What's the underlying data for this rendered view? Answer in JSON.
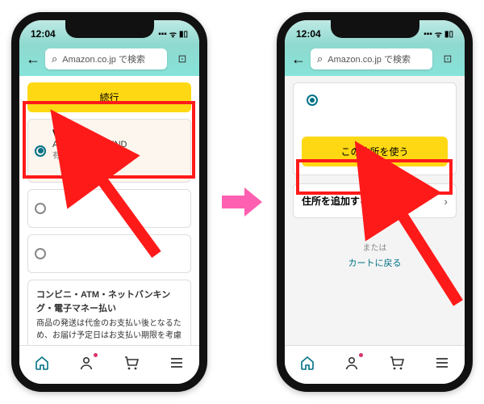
{
  "status": {
    "time": "12:04",
    "signal": "▪▪▪",
    "wifi": "ᯤ",
    "battery": "▮▯"
  },
  "header": {
    "search_placeholder": "Amazon.co.jp で検索"
  },
  "left": {
    "continue_label": "続行",
    "payment": {
      "brand": "Visa",
      "name": "ARIGATO FRIEND",
      "expiry_label": "有効期限は",
      "suffix": "です"
    },
    "other_heading": "コンビニ・ATM・ネットバンキング・電子マネー払い",
    "other_body": "商品の発送は代金のお支払い後となるため、お届け予定日はお支払い期限を考慮"
  },
  "right": {
    "use_address_label": "この住所を使う",
    "add_address_label": "住所を追加する",
    "or_label": "または",
    "back_cart_label": "カートに戻る"
  },
  "nav": {
    "home": "⌂",
    "account": "◯̀",
    "cart": "⟱",
    "menu": "☰"
  }
}
